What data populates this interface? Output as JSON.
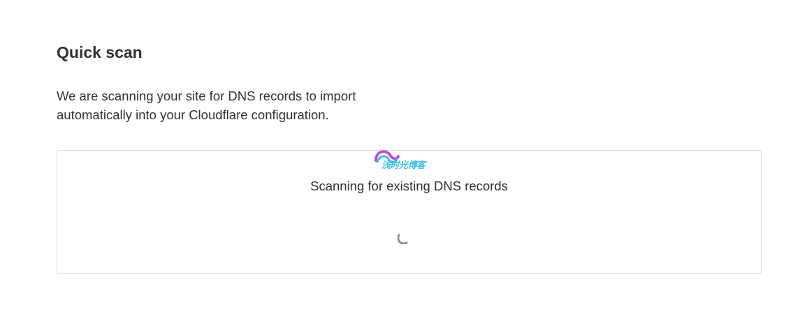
{
  "page": {
    "title": "Quick scan",
    "description": "We are scanning your site for DNS records to import automatically into your Cloudflare configuration."
  },
  "scan_card": {
    "status_text": "Scanning for existing DNS records",
    "spinner_icon": "loading-spinner-icon",
    "watermark_logo": "浅时光博客"
  },
  "colors": {
    "text": "#313131",
    "card_border": "#d9d9d9",
    "spinner": "#8a8a8a",
    "watermark_primary": "#39c0e8",
    "watermark_secondary": "#c847d6"
  }
}
